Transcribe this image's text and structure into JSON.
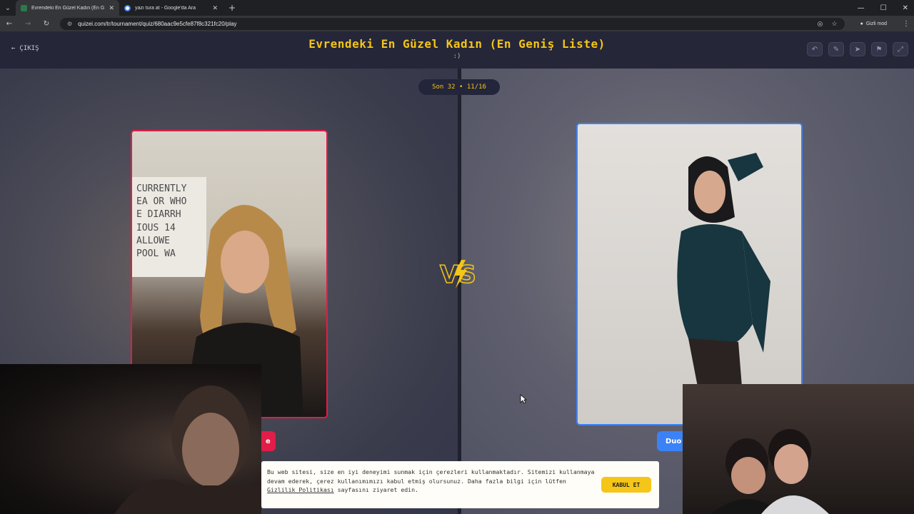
{
  "browser": {
    "tabs": [
      {
        "title": "Evrendeki En Güzel Kadın (En G",
        "active": true
      },
      {
        "title": "yazı tura at - Google'da Ara",
        "active": false
      }
    ],
    "url": "quizei.com/tr/tournament/quiz/680aac9e5cfe87f8c321fc20/play",
    "incognito_label": "Gizli mod"
  },
  "header": {
    "exit_label": "ÇIKIŞ",
    "title": "Evrendeki En Güzel Kadın (En Geniş Liste)",
    "subtitle": ":)"
  },
  "round": {
    "label": "Son 32 • 11/16"
  },
  "left_card": {
    "sign_lines": [
      "CURRENTLY",
      "EA OR WHO",
      "E DIARRH",
      "IOUS 14",
      "ALLOWE",
      "POOL WA"
    ],
    "name_label": "e"
  },
  "right_card": {
    "name_label": "Duo"
  },
  "cookie_banner": {
    "text_before_link": "Bu web sitesi, size en iyi deneyimi sunmak için çerezleri kullanmaktadır. Sitemizi kullanmaya devam ederek, çerez kullanımımızı kabul etmiş olursunuz. Daha fazla bilgi için lütfen ",
    "link_text": "Gizlilik Politikası",
    "text_after_link": " sayfasını ziyaret edin.",
    "accept_label": "KABUL ET"
  },
  "colors": {
    "accent_yellow": "#f5c518",
    "left_red": "#e11d48",
    "right_blue": "#3b82f6",
    "header_bg": "#252637"
  },
  "icons": {
    "header_actions": [
      "undo-icon",
      "edit-icon",
      "share-icon",
      "flag-icon",
      "fullscreen-icon"
    ]
  }
}
